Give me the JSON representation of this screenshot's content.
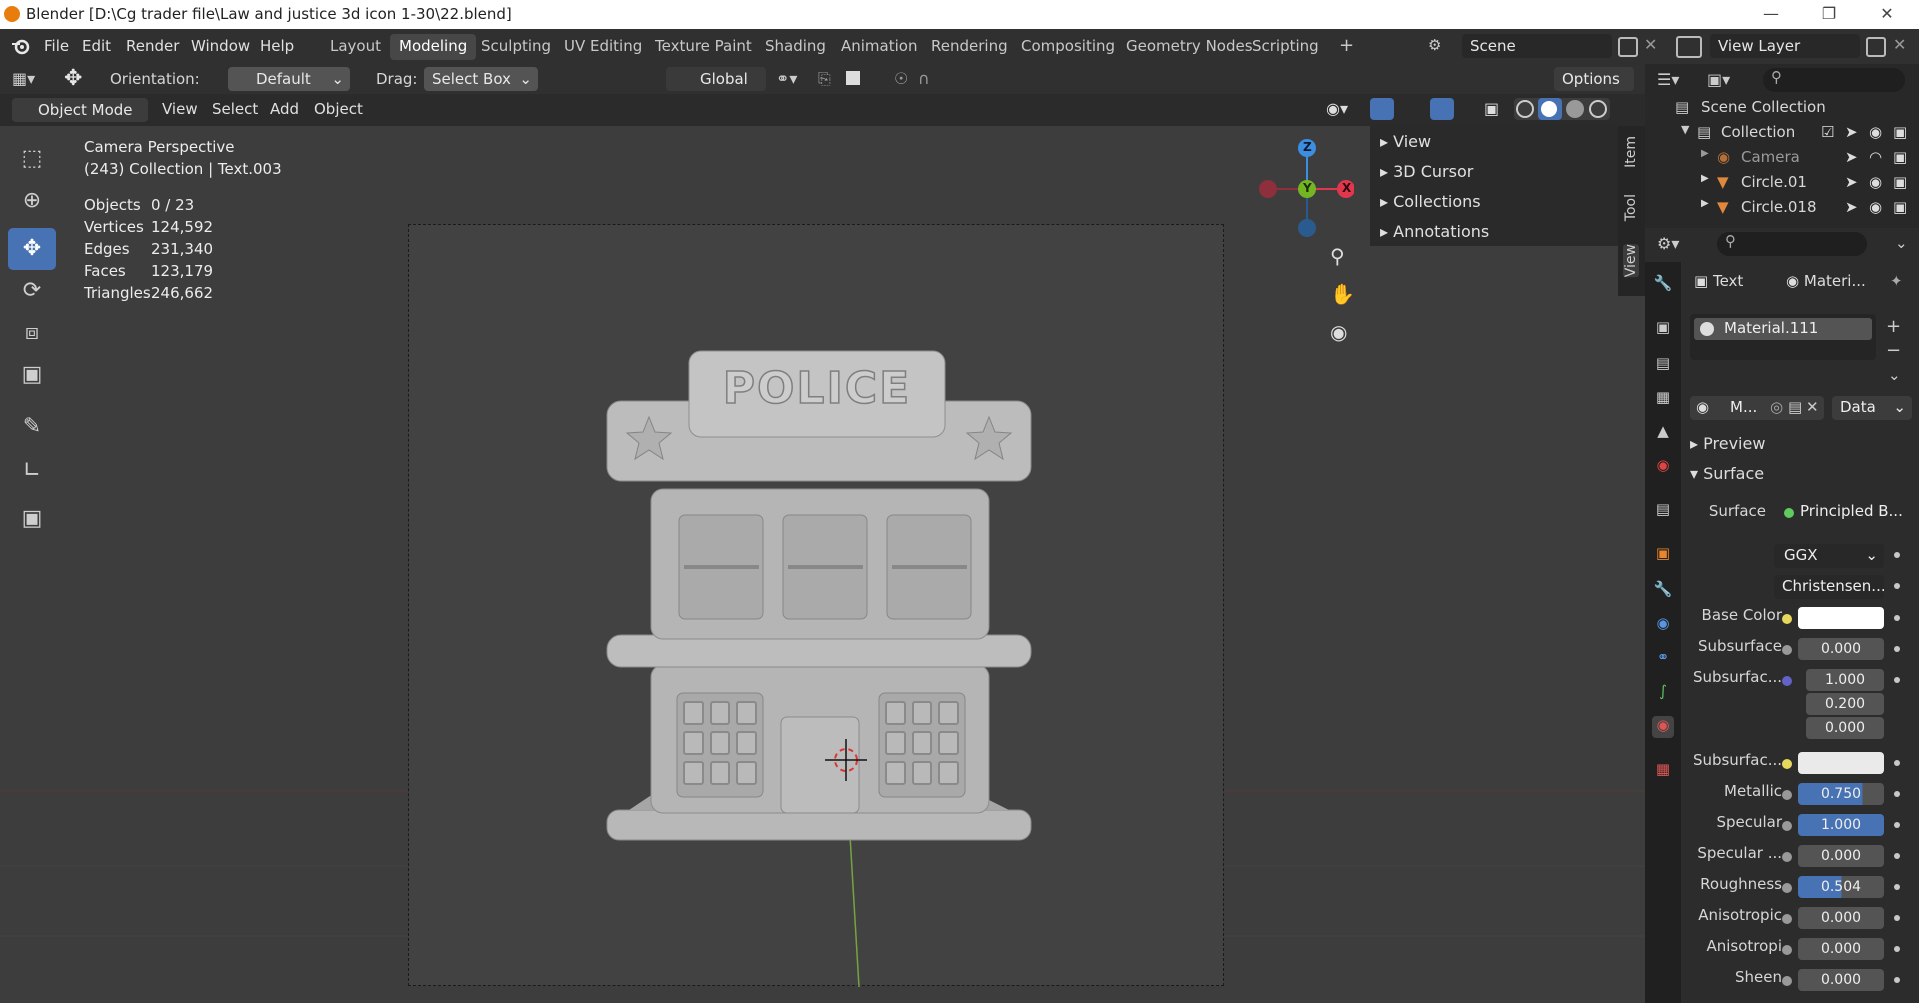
{
  "title": "Blender [D:\\Cg trader file\\Law and justice 3d icon 1-30\\22.blend]",
  "menu": [
    "File",
    "Edit",
    "Render",
    "Window",
    "Help"
  ],
  "workspaces": [
    "Layout",
    "Modeling",
    "Sculpting",
    "UV Editing",
    "Texture Paint",
    "Shading",
    "Animation",
    "Rendering",
    "Compositing",
    "Geometry Nodes",
    "Scripting"
  ],
  "scene": "Scene",
  "view_layer": "View Layer",
  "header": {
    "orientation_label": "Orientation:",
    "orientation_value": "Default",
    "drag_label": "Drag:",
    "drag_value": "Select Box",
    "transform": "Global",
    "options": "Options"
  },
  "mode": {
    "value": "Object Mode",
    "menus": [
      "View",
      "Select",
      "Add",
      "Object"
    ]
  },
  "overlay": {
    "camera": "Camera Perspective",
    "collection": "(243) Collection | Text.003",
    "stats": [
      {
        "label": "Objects",
        "value": "0 / 23"
      },
      {
        "label": "Vertices",
        "value": "124,592"
      },
      {
        "label": "Edges",
        "value": "231,340"
      },
      {
        "label": "Faces",
        "value": "123,179"
      },
      {
        "label": "Triangles",
        "value": "246,662"
      }
    ]
  },
  "model_text": "POLICE",
  "gizmo": {
    "z": "Z",
    "y": "Y",
    "x": "X"
  },
  "npanel": {
    "items": [
      "View",
      "3D Cursor",
      "Collections",
      "Annotations"
    ],
    "tabs": [
      "Item",
      "Tool",
      "View"
    ]
  },
  "outliner": {
    "root": "Scene Collection",
    "collection": "Collection",
    "children": [
      "Camera",
      "Circle.01",
      "Circle.018"
    ]
  },
  "properties": {
    "tab_text": "Text",
    "tab_material": "Materi...",
    "material_slot": "Material.111",
    "mat_short": "M...",
    "data_label": "Data",
    "sections": {
      "preview": "Preview",
      "surface": "Surface"
    },
    "surface_label": "Surface",
    "surface_value": "Principled B...",
    "distribution": "GGX",
    "subsurface_method": "Christensen...",
    "base_color_label": "Base Color",
    "subsurface_label": "Subsurface",
    "subsurface_value": "0.000",
    "subsurface_radius_label": "Subsurfac...",
    "subsurface_radius": [
      "1.000",
      "0.200",
      "0.000"
    ],
    "subsurface_color_label": "Subsurfac...",
    "metallic_label": "Metallic",
    "metallic": "0.750",
    "specular_label": "Specular",
    "specular": "1.000",
    "specular_tint_label": "Specular ...",
    "specular_tint": "0.000",
    "roughness_label": "Roughness",
    "roughness": "0.504",
    "anisotropic_label": "Anisotropic",
    "anisotropic": "0.000",
    "anisotropic_rot_label": "Anisotropi",
    "anisotropic_rot": "0.000",
    "sheen_label": "Sheen",
    "sheen": "0.000"
  },
  "colors": {
    "accent": "#4772b3",
    "active_blue": "#4772b3",
    "axis_x": "#e1374d",
    "axis_y": "#74b524",
    "axis_z": "#3c8ee0"
  }
}
